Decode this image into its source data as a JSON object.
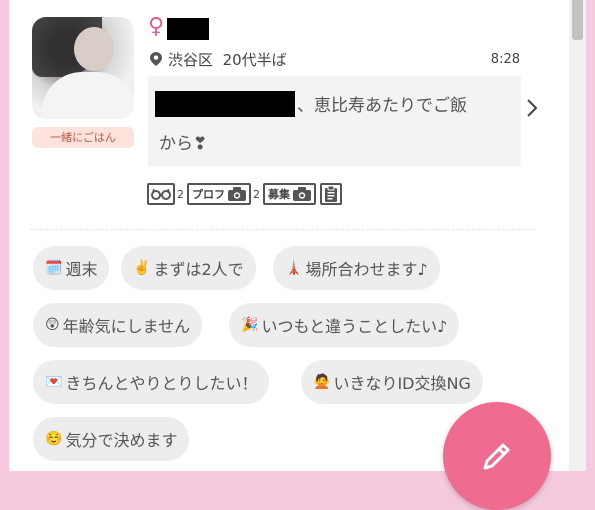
{
  "profile": {
    "gender_symbol": "♀",
    "location": "渋谷区",
    "age": "20代半ば",
    "time": "8:28",
    "tag": "一緒にごはん",
    "message_line1": "、恵比寿あたりでご飯",
    "message_line2": "から❣"
  },
  "stats": {
    "footprints": "2",
    "profile_label": "プロフ",
    "profile_photos": "2",
    "recruit_label": "募集"
  },
  "chips": [
    {
      "emoji": "🗓️",
      "label": "週末"
    },
    {
      "emoji": "✌️",
      "label": "まずは2人で"
    },
    {
      "emoji": "🗼",
      "label": "場所合わせます♪"
    },
    {
      "emoji": "😲",
      "label": "年齢気にしません"
    },
    {
      "emoji": "🎉",
      "label": "いつもと違うことしたい♪"
    },
    {
      "emoji": "💌",
      "label": "きちんとやりとりしたい！"
    },
    {
      "emoji": "🙅",
      "label": "いきなりID交換NG"
    },
    {
      "emoji": "☺️",
      "label": "気分で決めます"
    }
  ],
  "icons": {
    "gender": "female-symbol-icon",
    "location": "map-pin-icon",
    "chevron": "chevron-right-icon",
    "footprints": "glasses-icon",
    "camera": "camera-icon",
    "document": "document-icon",
    "fab": "pencil-icon"
  },
  "colors": {
    "accent": "#e05d9a",
    "fab": "#ef6b90",
    "page_bg": "#f7c9df",
    "tag_bg": "#fde3dc"
  }
}
